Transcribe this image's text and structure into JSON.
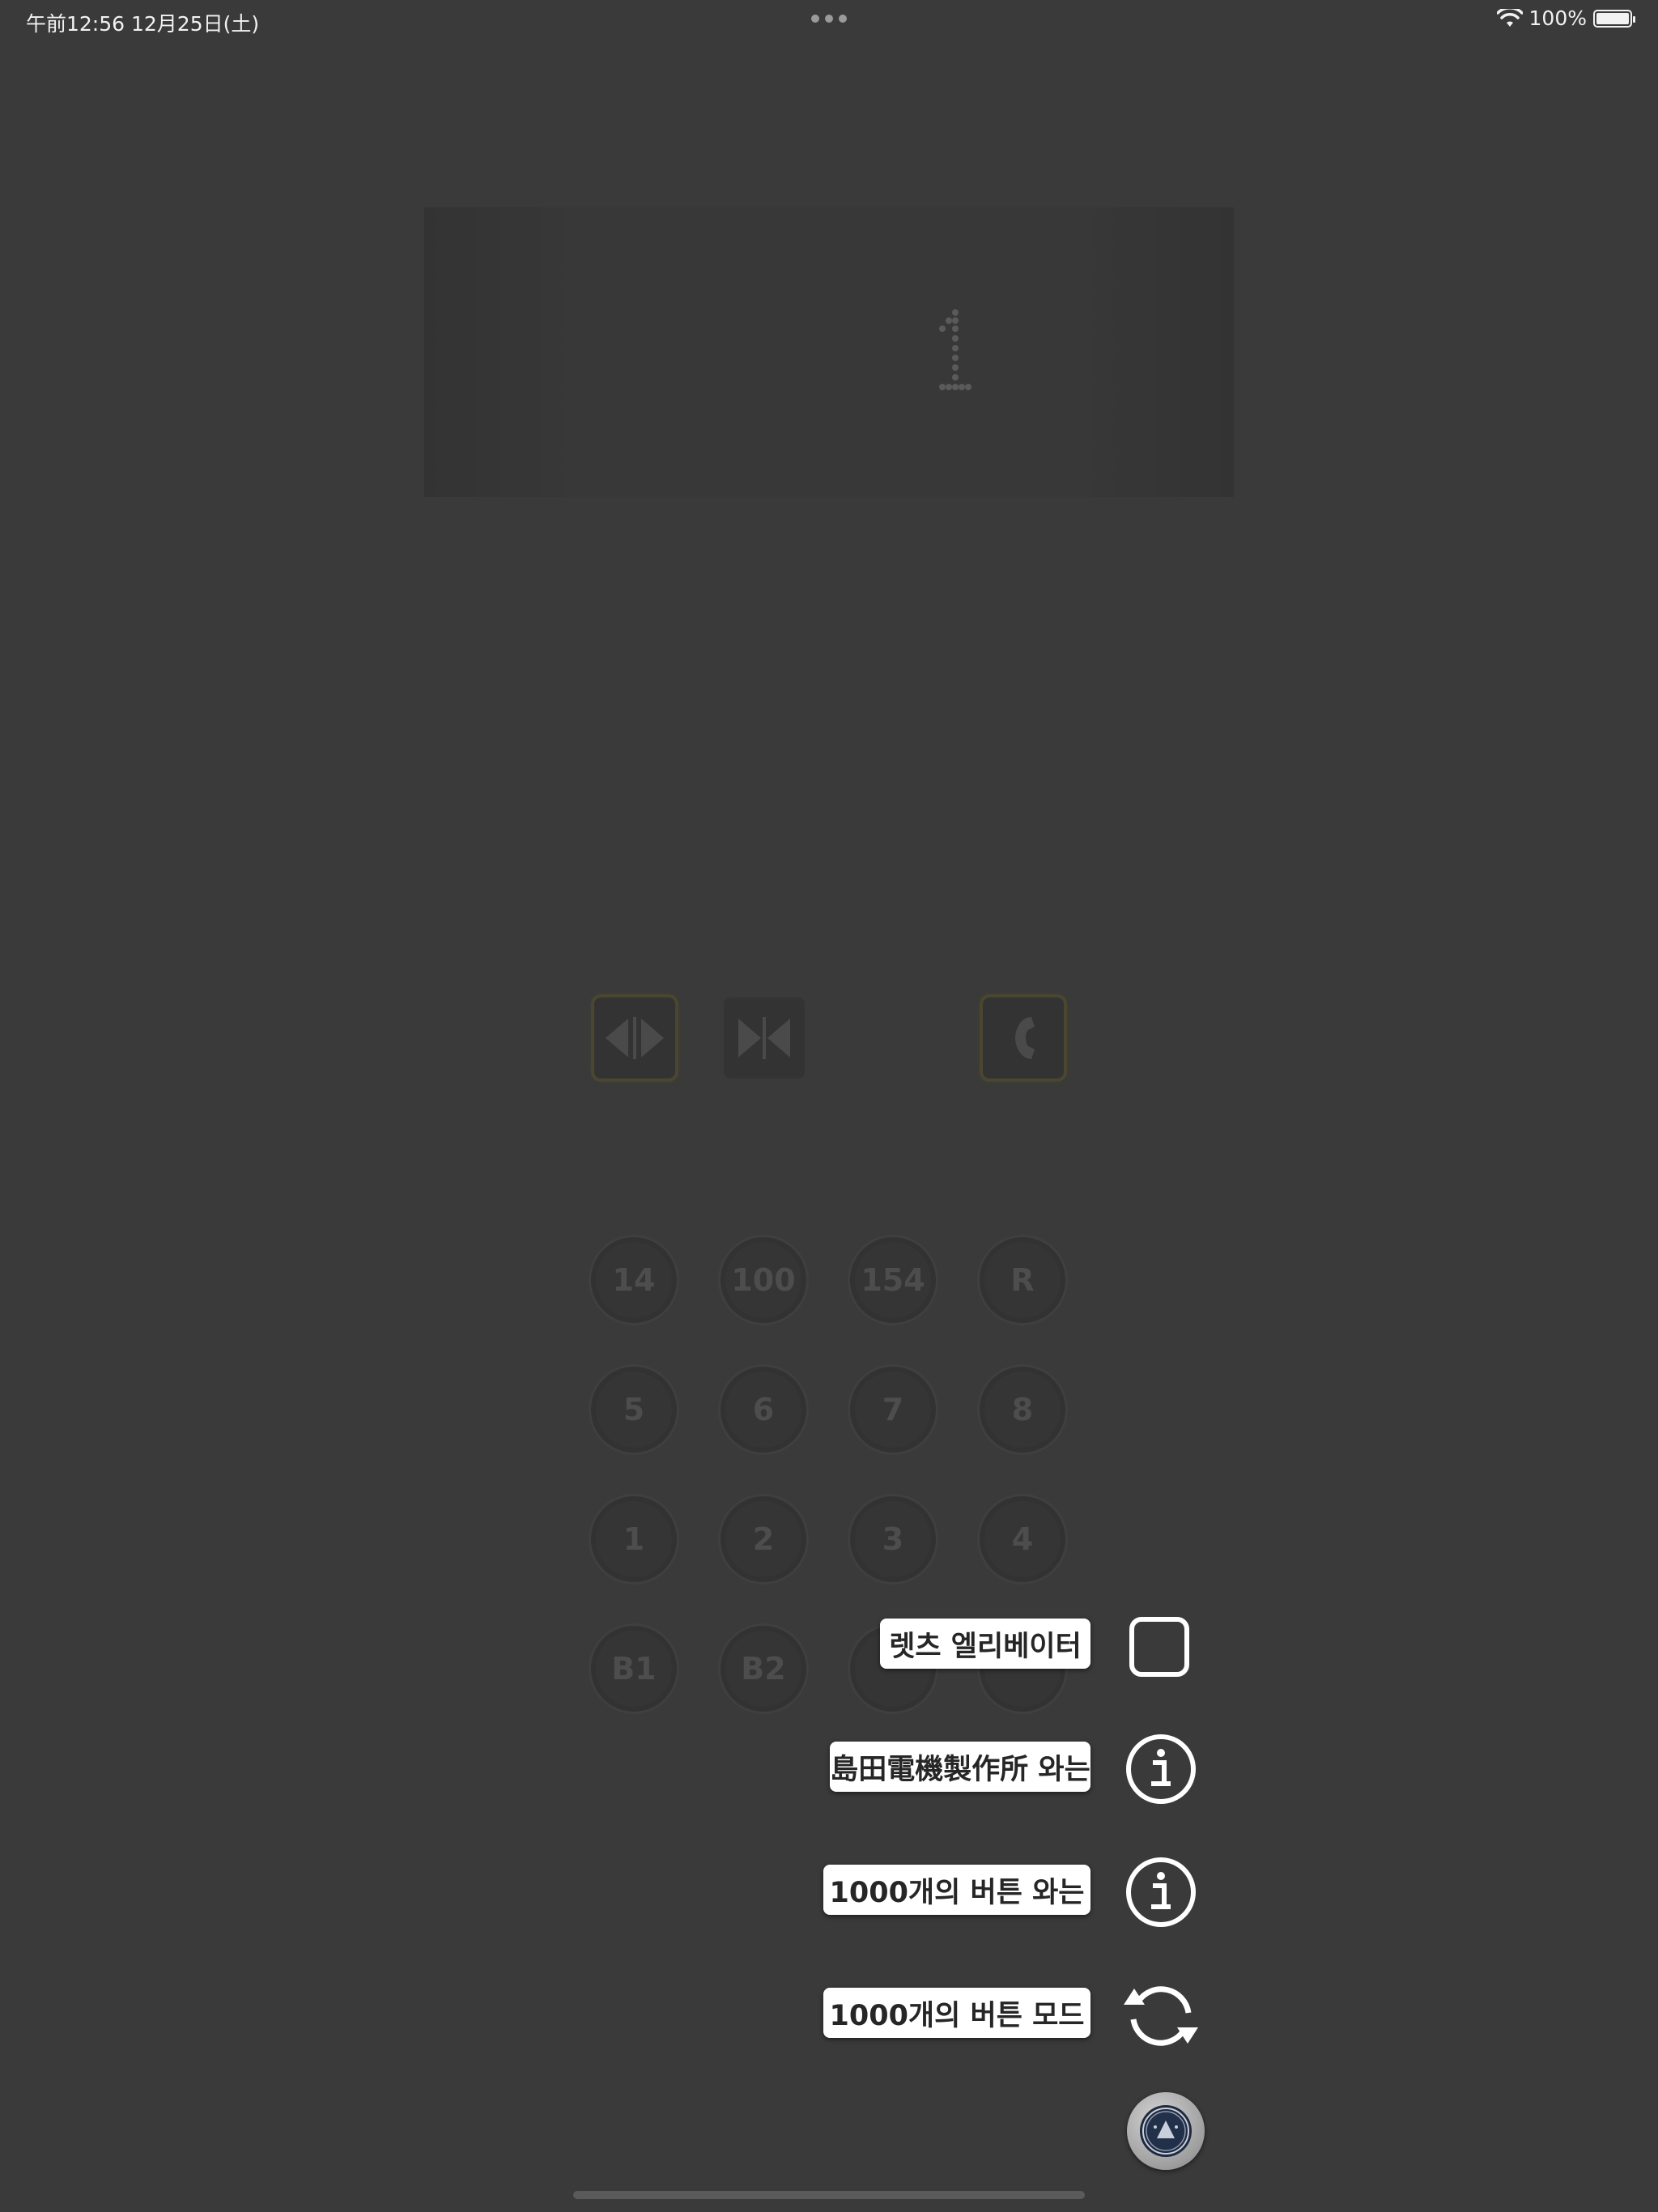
{
  "status_bar": {
    "time_date": "午前12:56   12月25日(土)",
    "battery": "100%",
    "battery_level": 1.0
  },
  "display": {
    "floor": "1"
  },
  "controls": [
    {
      "name": "door-open-button",
      "icon": "door-open-icon"
    },
    {
      "name": "door-close-button",
      "icon": "door-close-icon"
    },
    {
      "name": "emergency-call-button",
      "icon": "phone-icon"
    }
  ],
  "floor_buttons": [
    [
      "14",
      "100",
      "154",
      "R"
    ],
    [
      "5",
      "6",
      "7",
      "8"
    ],
    [
      "1",
      "2",
      "3",
      "4"
    ],
    [
      "B1",
      "B2",
      "",
      ""
    ]
  ],
  "menu": {
    "items": [
      {
        "label": "렛츠 엘리베이터",
        "icon": "square-icon"
      },
      {
        "label": "島田電機製作所 와는",
        "icon": "info-icon"
      },
      {
        "label": "1000개의 버튼 와는",
        "icon": "info-icon"
      },
      {
        "label": "1000개의 버튼 모드",
        "icon": "refresh-icon"
      }
    ],
    "fab_icon": "elevator-up-icon"
  }
}
